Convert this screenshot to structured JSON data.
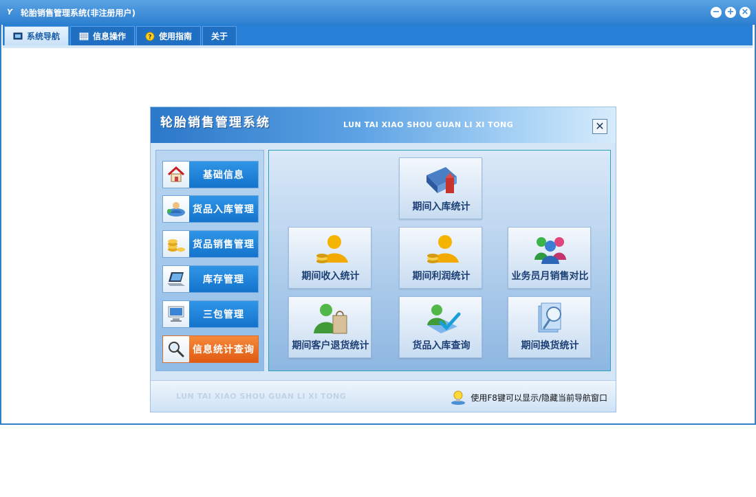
{
  "window": {
    "title": "轮胎销售管理系统(非注册用户)",
    "controls": [
      "minimize",
      "restore",
      "close"
    ]
  },
  "tabs": [
    {
      "label": "系统导航",
      "icon": "monitor-icon",
      "active": true
    },
    {
      "label": "信息操作",
      "icon": "grid-icon",
      "active": false
    },
    {
      "label": "使用指南",
      "icon": "help-icon",
      "active": false
    },
    {
      "label": "关于",
      "icon": "",
      "active": false
    }
  ],
  "dialog": {
    "title": "轮胎销售管理系统",
    "subtitle": "LUN TAI XIAO SHOU GUAN LI XI TONG",
    "close_glyph": "✕",
    "footer_subtitle": "LUN TAI XIAO SHOU GUAN LI XI TONG",
    "tip": "使用F8键可以显示/隐藏当前导航窗口"
  },
  "nav": [
    {
      "label": "基础信息",
      "icon": "house-icon",
      "active": false
    },
    {
      "label": "货品入库管理",
      "icon": "user-network-icon",
      "active": false
    },
    {
      "label": "货品销售管理",
      "icon": "coins-icon",
      "active": false
    },
    {
      "label": "库存管理",
      "icon": "laptop-icon",
      "active": false
    },
    {
      "label": "三包管理",
      "icon": "computer-icon",
      "active": false
    },
    {
      "label": "信息统计查询",
      "icon": "magnifier-icon",
      "active": true
    }
  ],
  "tiles": [
    {
      "label": "期间入库统计",
      "icon": "books-icon"
    },
    {
      "label": "期间收入统计",
      "icon": "user-coins-icon"
    },
    {
      "label": "期间利润统计",
      "icon": "user-coins-icon"
    },
    {
      "label": "业务员月销售对比",
      "icon": "group-icon"
    },
    {
      "label": "期间客户退货统计",
      "icon": "user-bag-icon"
    },
    {
      "label": "货品入库查询",
      "icon": "user-check-icon"
    },
    {
      "label": "期间换货统计",
      "icon": "document-search-icon"
    }
  ],
  "colors": {
    "title_bar": "#3a8ad8",
    "tab_bar": "#2780d6",
    "nav_blue": "#1f86dc",
    "nav_active": "#e8661e",
    "tile_text": "#1b3f74"
  }
}
